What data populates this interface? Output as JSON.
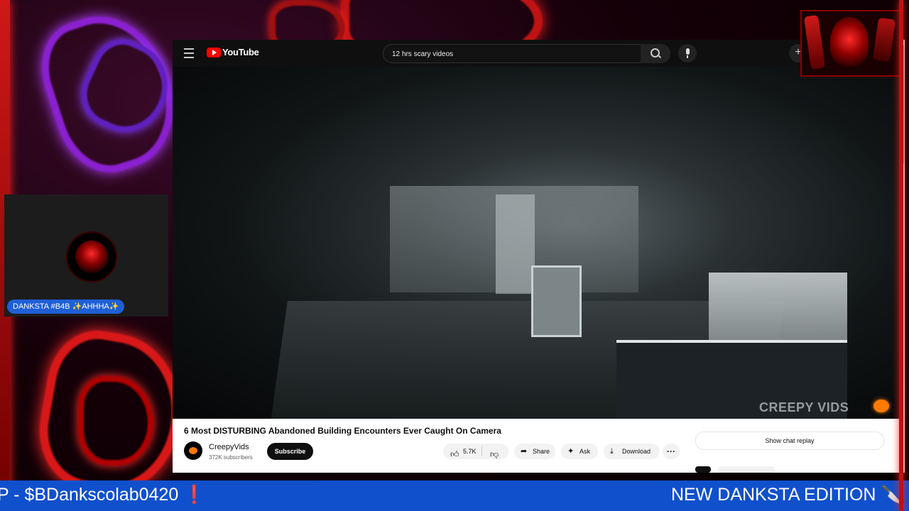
{
  "overlay": {
    "webcam_label": "DANKSTA #B4B ✨AHHHA✨",
    "ticker_left": "P - $BDankscolab0420 ❗",
    "ticker_right": "NEW DANKSTA EDITION 🔪"
  },
  "youtube": {
    "logo_text": "YouTube",
    "search_query": "12 hrs scary videos",
    "create_label": "+",
    "player": {
      "watermark": "CREEPY VIDS"
    },
    "video": {
      "title": "6 Most DISTURBING Abandoned Building Encounters Ever Caught On Camera",
      "channel_name": "CreepyVids",
      "subscribers": "372K subscribers",
      "subscribe_label": "Subscribe",
      "likes": "5.7K",
      "share_label": "Share",
      "ask_label": "Ask",
      "download_label": "Download",
      "more_label": "···"
    },
    "chat_replay_label": "Show chat replay"
  },
  "colors": {
    "ticker_bg": "#1050cc",
    "youtube_red": "#ff0000",
    "neon_red": "#d01818",
    "neon_purple": "#8a20d0"
  },
  "icons": [
    "menu-icon",
    "youtube-logo-icon",
    "search-icon",
    "mic-icon",
    "plus-icon",
    "thumbs-up-icon",
    "thumbs-down-icon",
    "share-icon",
    "ask-sparkle-icon",
    "download-icon",
    "more-icon"
  ]
}
